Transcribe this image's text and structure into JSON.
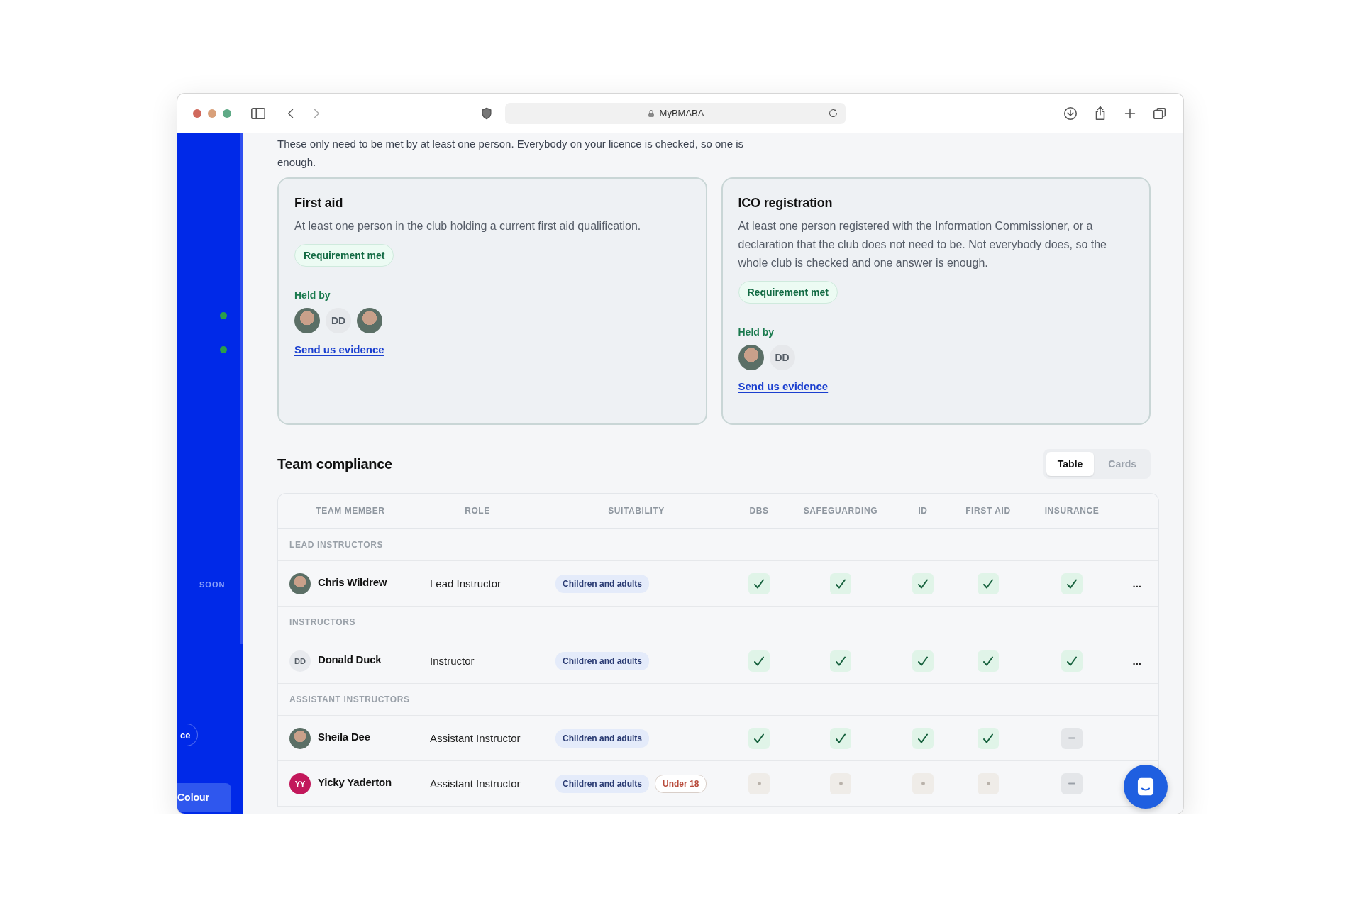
{
  "browser": {
    "address": "MyBMABA"
  },
  "sidebar": {
    "nav_dots": [
      {
        "on": true
      },
      {
        "on": true
      }
    ],
    "soon_label": "SOON",
    "pill": "ce",
    "button": "Colour"
  },
  "intro": "These only need to be met by at least one person. Everybody on your licence is checked, so one is enough.",
  "requirements": [
    {
      "title": "First aid",
      "description": "At least one person in the club holding a current first aid qualification.",
      "status": "Requirement met",
      "met": true,
      "held_by_label": "Held by",
      "held_by": [
        {
          "kind": "photo"
        },
        {
          "kind": "initials",
          "initials": "DD"
        },
        {
          "kind": "photo"
        }
      ],
      "link": "Send us evidence"
    },
    {
      "title": "ICO registration",
      "description": "At least one person registered with the Information Commissioner, or a declaration that the club does not need to be. Not everybody does, so the whole club is checked and one answer is enough.",
      "status": "Requirement met",
      "met": true,
      "held_by_label": "Held by",
      "held_by": [
        {
          "kind": "photo"
        },
        {
          "kind": "initials",
          "initials": "DD"
        }
      ],
      "link": "Send us evidence"
    }
  ],
  "team": {
    "title": "Team compliance",
    "views": [
      {
        "label": "Table",
        "selected": true
      },
      {
        "label": "Cards",
        "selected": false
      }
    ],
    "columns": [
      "TEAM MEMBER",
      "ROLE",
      "SUITABILITY",
      "DBS",
      "SAFEGUARDING",
      "ID",
      "FIRST AID",
      "INSURANCE"
    ],
    "groups": [
      {
        "label": "LEAD INSTRUCTORS",
        "members": [
          {
            "avatar": {
              "kind": "photo"
            },
            "name": "Chris Wildrew",
            "role": "Lead Instructor",
            "tags": [
              {
                "kind": "suitability",
                "label": "Children and adults"
              }
            ],
            "checks": [
              {
                "kind": "met"
              },
              {
                "kind": "met"
              },
              {
                "kind": "met"
              },
              {
                "kind": "met"
              },
              {
                "kind": "met"
              }
            ],
            "menu": "..."
          }
        ]
      },
      {
        "label": "INSTRUCTORS",
        "members": [
          {
            "avatar": {
              "kind": "initials",
              "initials": "DD",
              "color": "#e8eaee"
            },
            "name": "Donald Duck",
            "role": "Instructor",
            "tags": [
              {
                "kind": "suitability",
                "label": "Children and adults"
              }
            ],
            "checks": [
              {
                "kind": "met"
              },
              {
                "kind": "met"
              },
              {
                "kind": "met"
              },
              {
                "kind": "met"
              },
              {
                "kind": "met"
              }
            ],
            "menu": "..."
          }
        ]
      },
      {
        "label": "ASSISTANT INSTRUCTORS",
        "members": [
          {
            "avatar": {
              "kind": "photo"
            },
            "name": "Sheila Dee",
            "role": "Assistant Instructor",
            "tags": [
              {
                "kind": "suitability",
                "label": "Children and adults"
              }
            ],
            "checks": [
              {
                "kind": "met"
              },
              {
                "kind": "met"
              },
              {
                "kind": "met"
              },
              {
                "kind": "met"
              },
              {
                "kind": "missing"
              }
            ]
          },
          {
            "avatar": {
              "kind": "initials",
              "initials": "YY",
              "color": "#c2185b"
            },
            "name": "Yicky Yaderton",
            "role": "Assistant Instructor",
            "tags": [
              {
                "kind": "suitability",
                "label": "Children and adults"
              },
              {
                "kind": "age",
                "label": "Under 18"
              }
            ],
            "checks": [
              {
                "kind": "pending"
              },
              {
                "kind": "pending"
              },
              {
                "kind": "pending"
              },
              {
                "kind": "pending"
              },
              {
                "kind": "missing"
              }
            ]
          }
        ]
      }
    ]
  }
}
